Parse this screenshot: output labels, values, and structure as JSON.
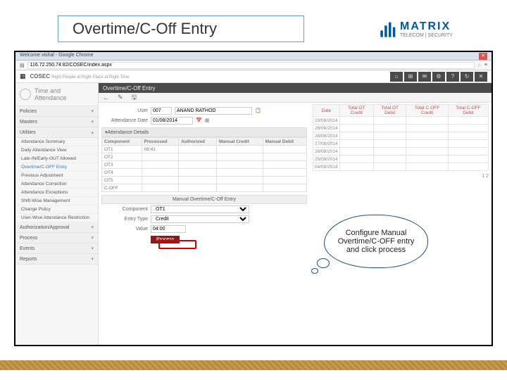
{
  "slide": {
    "title": "Overtime/C-Off Entry"
  },
  "logo": {
    "name": "MATRIX",
    "sub": "TELECOM | SECURITY"
  },
  "chrome": {
    "tab": "Welcome vishal - Google Chrome",
    "url": "116.72.250.74:82/COSEC/index.aspx"
  },
  "app": {
    "brand": "COSEC",
    "tagline": "Right People at Right Place at Right Time",
    "header_icons": [
      "⌂",
      "⊞",
      "✉",
      "⚙",
      "?",
      "↻",
      "✕"
    ]
  },
  "leftbar": {
    "title": "Time and Attendance",
    "sections": [
      {
        "label": "Policies"
      },
      {
        "label": "Masters"
      },
      {
        "label": "Utilities",
        "open": true,
        "items": [
          "Attendance Summary",
          "Daily Attendance View",
          "Late-IN/Early-OUT Allowed",
          "Overtime/C-OFF Entry",
          "Previous Adjustment",
          "Attendance Correction",
          "Attendance Exceptions",
          "Shift-Wise Management",
          "Change Policy",
          "User-Wise Attendance Restriction"
        ],
        "active_index": 3
      },
      {
        "label": "Authorization/Approval"
      },
      {
        "label": "Process"
      },
      {
        "label": "Events"
      },
      {
        "label": "Reports"
      }
    ]
  },
  "main": {
    "title": "Overtime/C-Off Entry",
    "form": {
      "user_label": "User",
      "user_code": "007",
      "user_name": "ANAND RATHOD",
      "att_date_label": "Attendance Date",
      "att_date": "01/08/2014"
    },
    "acc_header": "Attendance Details",
    "table": {
      "cols": [
        "Component",
        "Processed",
        "Authorized",
        "Manual Credit",
        "Manual Debit"
      ],
      "rows": [
        {
          "c": "OT1",
          "p": "08:41",
          "a": "",
          "mc": "",
          "md": ""
        },
        {
          "c": "OT2",
          "p": "",
          "a": "",
          "mc": "",
          "md": ""
        },
        {
          "c": "OT3",
          "p": "",
          "a": "",
          "mc": "",
          "md": ""
        },
        {
          "c": "OT4",
          "p": "",
          "a": "",
          "mc": "",
          "md": ""
        },
        {
          "c": "OT5",
          "p": "",
          "a": "",
          "mc": "",
          "md": ""
        },
        {
          "c": "C-OFF",
          "p": "",
          "a": "",
          "mc": "",
          "md": ""
        }
      ]
    },
    "manual": {
      "title": "Manual Overtime/C-Off Entry",
      "comp_label": "Component",
      "comp_value": "OT1",
      "type_label": "Entry Type",
      "type_value": "Credit",
      "val_label": "Value",
      "val_value": "04:00",
      "process": "Process"
    }
  },
  "rtable": {
    "cols": [
      "Date",
      "Total OT Credit",
      "Total OT Debit",
      "Total C-OFF Credit",
      "Total C-OFF Debit"
    ],
    "rows": [
      "29/08/2014",
      "28/08/2014",
      "28/08/2014",
      "27/08/2014",
      "26/08/2014",
      "25/08/2014",
      "04/08/2014"
    ],
    "pager": "1  2"
  },
  "speech": "Configure Manual Overtime/C-OFF entry and click process"
}
